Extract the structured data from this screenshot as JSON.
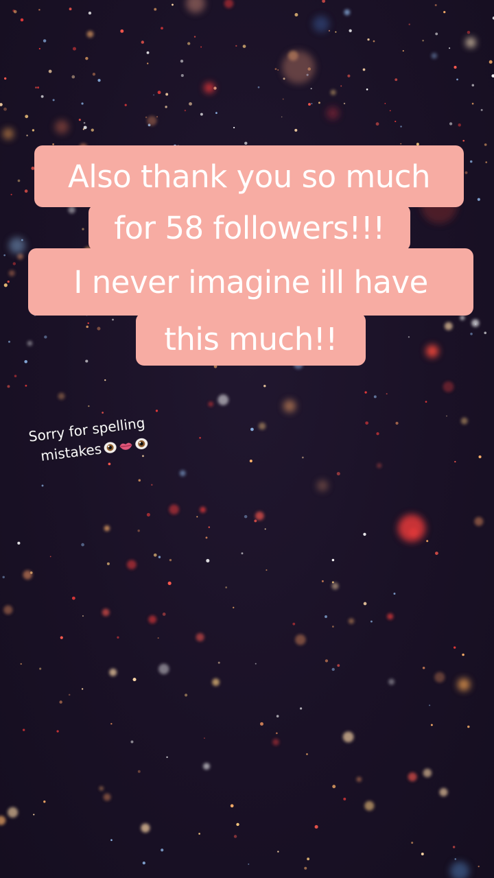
{
  "caption": {
    "lines": [
      "Also thank you so much",
      "for 58 followers!!!",
      "I never imagine ill have",
      "this much!!"
    ]
  },
  "note": {
    "line1": "Sorry for spelling",
    "line2": "mistakes",
    "emojis": [
      "eye-icon",
      "lips-icon",
      "eye-icon"
    ]
  },
  "colors": {
    "caption_bg": "#f7aca3",
    "caption_text": "#ffffff",
    "background": "#1b1228"
  }
}
